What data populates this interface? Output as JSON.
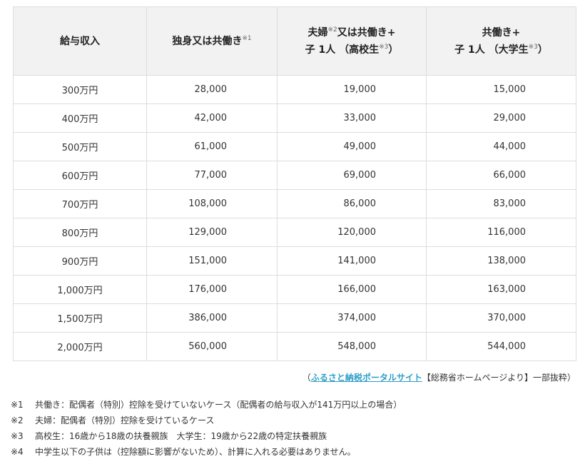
{
  "table": {
    "headers": [
      {
        "line1": "給与収入",
        "sup1": "",
        "line2": "",
        "sup2": "",
        "line2_close": ""
      },
      {
        "line1": "独身又は共働き",
        "sup1": "※1",
        "line2": "",
        "sup2": "",
        "line2_close": ""
      },
      {
        "line1_a": "夫婦",
        "sup1": "※2",
        "line1_b": "又は共働き+",
        "line2": "子 1人 （高校生",
        "sup2": "※3",
        "line2_close": "）"
      },
      {
        "line1": "共働き+",
        "sup1": "",
        "line2": "子 1人 （大学生",
        "sup2": "※3",
        "line2_close": "）"
      }
    ],
    "rows": [
      [
        "300万円",
        "28,000",
        "19,000",
        "15,000"
      ],
      [
        "400万円",
        "42,000",
        "33,000",
        "29,000"
      ],
      [
        "500万円",
        "61,000",
        "49,000",
        "44,000"
      ],
      [
        "600万円",
        "77,000",
        "69,000",
        "66,000"
      ],
      [
        "700万円",
        "108,000",
        "86,000",
        "83,000"
      ],
      [
        "800万円",
        "129,000",
        "120,000",
        "116,000"
      ],
      [
        "900万円",
        "151,000",
        "141,000",
        "138,000"
      ],
      [
        "1,000万円",
        "176,000",
        "166,000",
        "163,000"
      ],
      [
        "1,500万円",
        "386,000",
        "374,000",
        "370,000"
      ],
      [
        "2,000万円",
        "560,000",
        "548,000",
        "544,000"
      ]
    ]
  },
  "source": {
    "open": "（",
    "link_text": "ふるさと納税ポータルサイト",
    "rest": "【総務省ホームページより】一部抜粋）"
  },
  "notes": [
    {
      "mark": "※1",
      "text": "共働き：配偶者（特別）控除を受けていないケース（配偶者の給与収入が141万円以上の場合）"
    },
    {
      "mark": "※2",
      "text": "夫婦：配偶者（特別）控除を受けているケース"
    },
    {
      "mark": "※3",
      "text": "高校生：16歳から18歳の扶養親族　大学生：19歳から22歳の特定扶養親族"
    },
    {
      "mark": "※4",
      "text": "中学生以下の子供は（控除額に影響がないため）、計算に入れる必要はありません。"
    }
  ],
  "colors": {
    "header_bg": "#f2f2f2",
    "border": "#dddddd",
    "link": "#2e9fc7"
  }
}
